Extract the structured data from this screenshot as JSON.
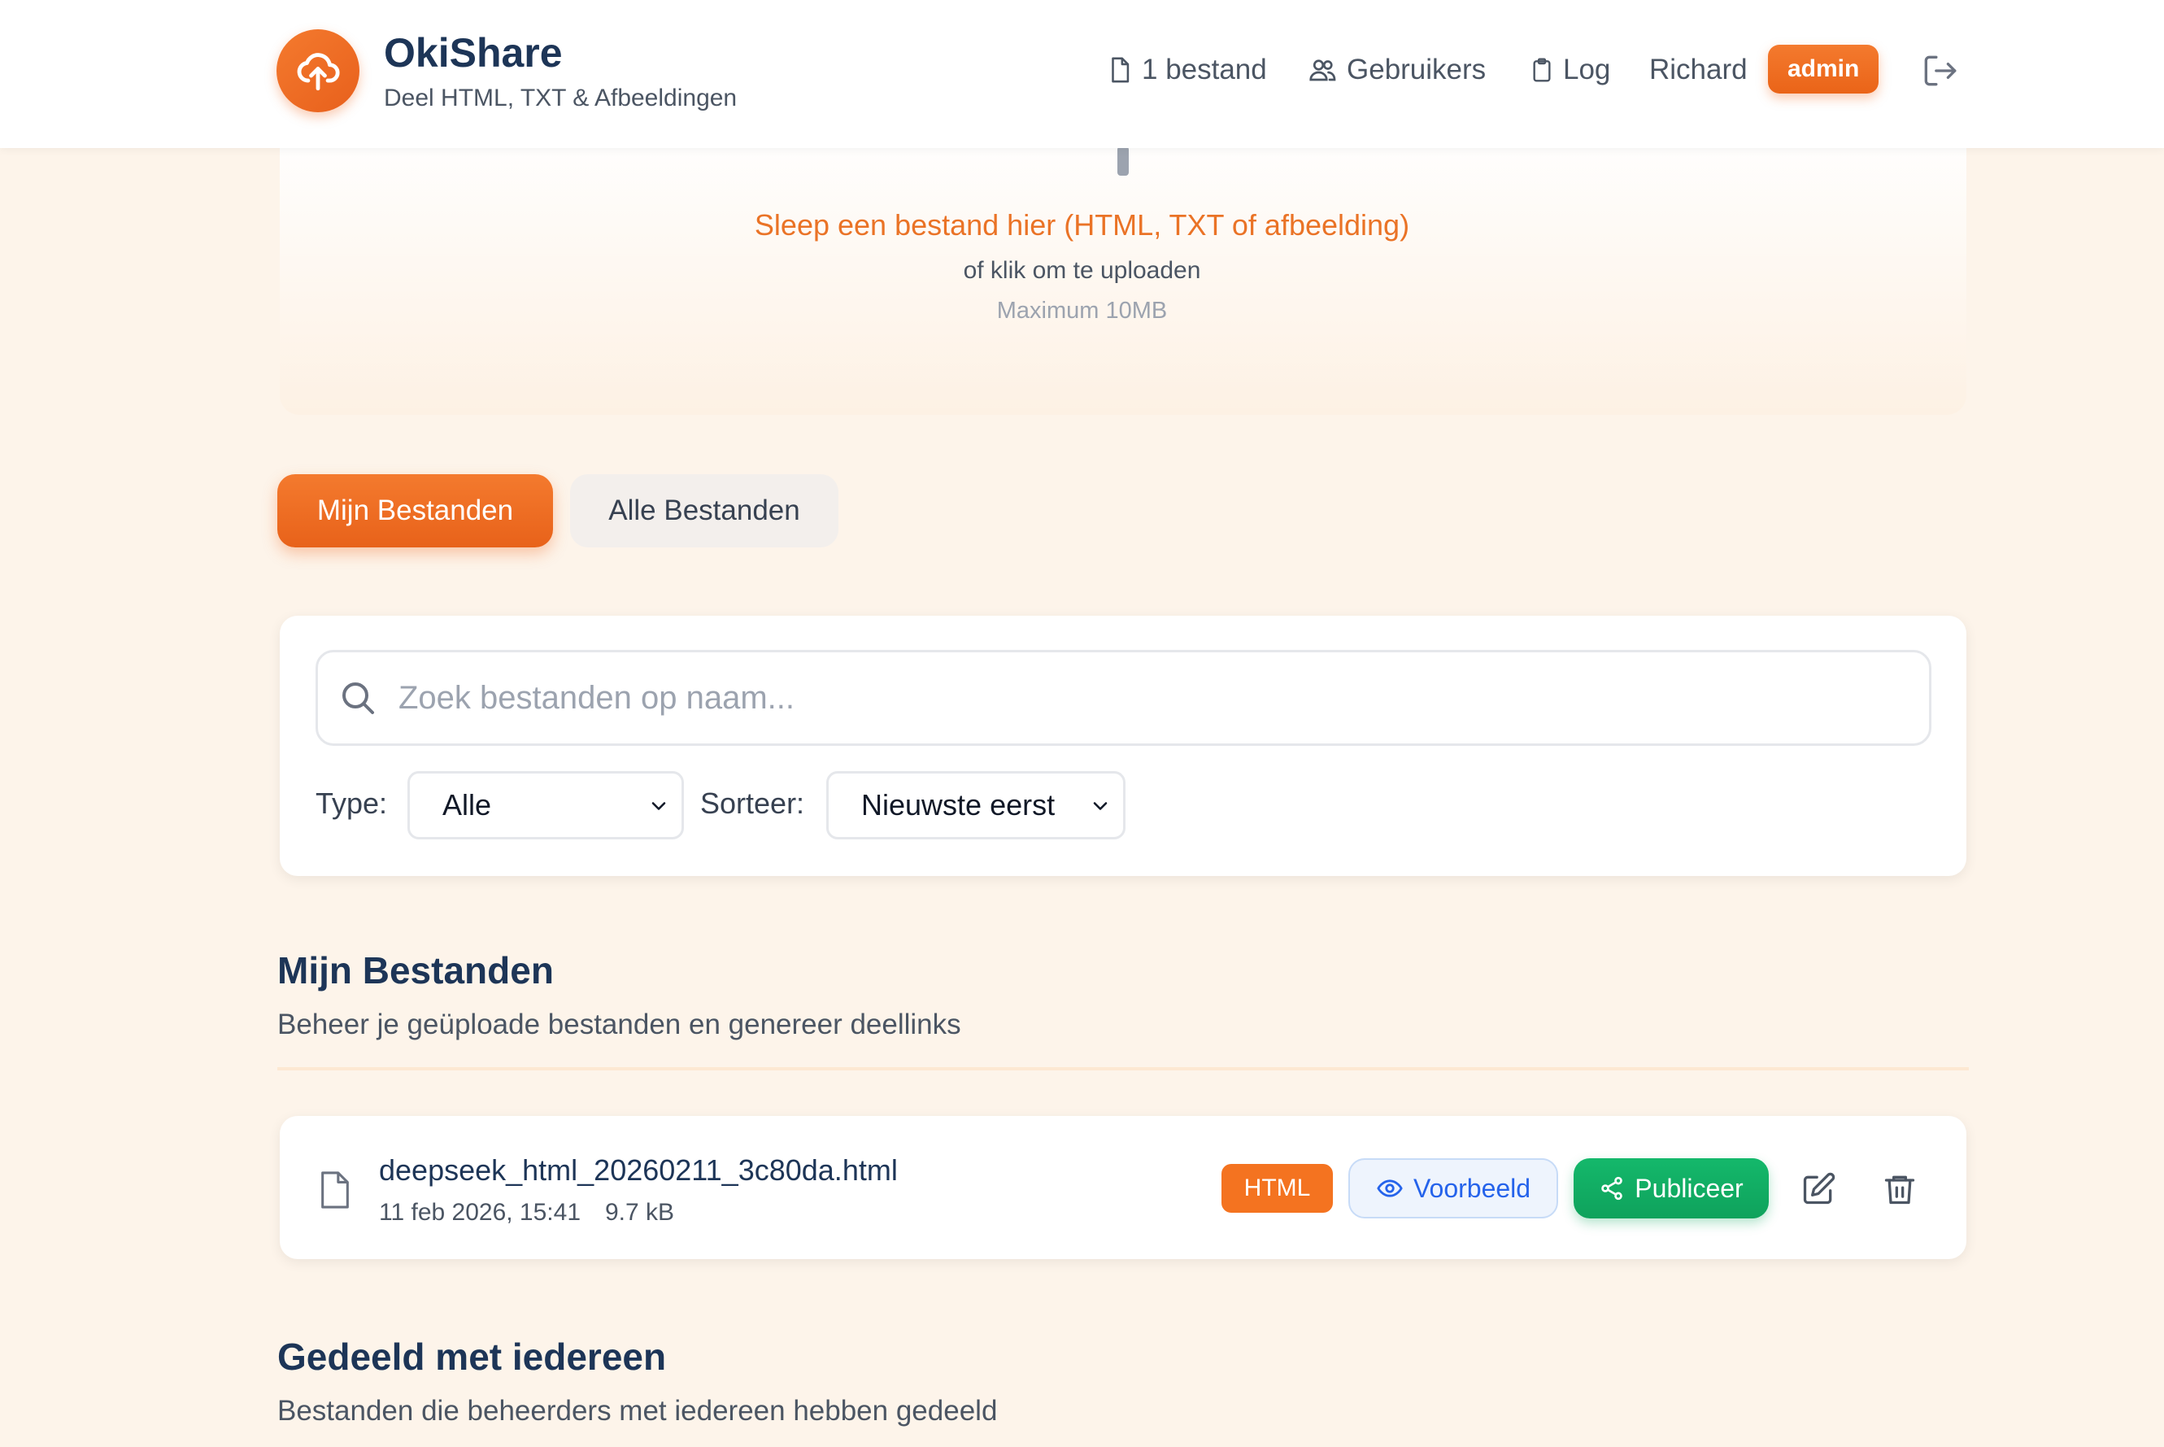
{
  "header": {
    "app_title": "OkiShare",
    "app_subtitle": "Deel HTML, TXT & Afbeeldingen",
    "nav": {
      "files": "1 bestand",
      "users": "Gebruikers",
      "log": "Log",
      "user_name": "Richard",
      "role_badge": "admin"
    },
    "icons": [
      "upload-cloud-icon",
      "file-icon",
      "users-icon",
      "clipboard-icon",
      "logout-icon"
    ]
  },
  "upload": {
    "title": "Sleep een bestand hier (HTML, TXT of afbeelding)",
    "subtitle": "of klik om te uploaden",
    "max_size": "Maximum 10MB"
  },
  "tabs": [
    {
      "label": "Mijn Bestanden",
      "active": true
    },
    {
      "label": "Alle Bestanden",
      "active": false
    }
  ],
  "filters": {
    "search_placeholder": "Zoek bestanden op naam...",
    "type_label": "Type:",
    "type_value": "Alle",
    "sort_label": "Sorteer:",
    "sort_value": "Nieuwste eerst"
  },
  "my_files": {
    "title": "Mijn Bestanden",
    "subtitle": "Beheer je geüploade bestanden en genereer deellinks",
    "items": [
      {
        "name": "deepseek_html_20260211_3c80da.html",
        "date": "11 feb 2026, 15:41",
        "size": "9.7 kB",
        "type_badge": "HTML",
        "preview_label": "Voorbeeld",
        "publish_label": "Publiceer"
      }
    ]
  },
  "shared": {
    "title": "Gedeeld met iedereen",
    "subtitle": "Bestanden die beheerders met iedereen hebben gedeeld"
  },
  "colors": {
    "accent": "#f47a2e",
    "navy": "#1d3557",
    "success": "#12b066",
    "info": "#2563eb",
    "background": "#fdf4ea"
  }
}
